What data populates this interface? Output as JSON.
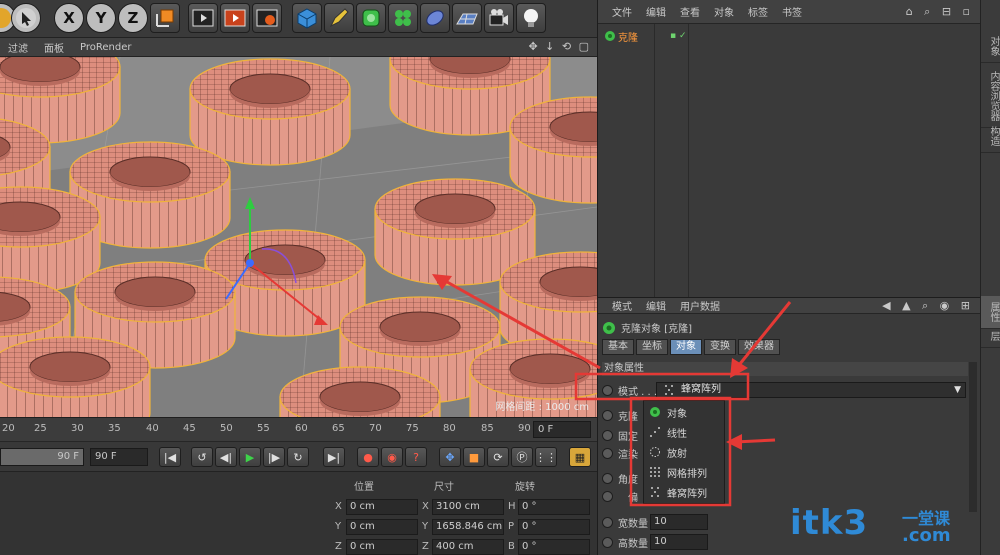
{
  "toolbar": {
    "buttons": [
      {
        "icon": "undo-icon"
      },
      {
        "icon": "select-arrow-icon"
      },
      {
        "icon": "x-axis-lock-icon",
        "label": "X"
      },
      {
        "icon": "y-axis-lock-icon",
        "label": "Y"
      },
      {
        "icon": "z-axis-lock-icon",
        "label": "Z"
      },
      {
        "icon": "coordinate-system-icon"
      },
      {
        "icon": "render-view-icon"
      },
      {
        "icon": "render-picture-viewer-icon"
      },
      {
        "icon": "render-settings-icon"
      },
      {
        "icon": "cube-icon"
      },
      {
        "icon": "pen-icon"
      },
      {
        "icon": "subdivision-icon"
      },
      {
        "icon": "cloner-icon"
      },
      {
        "icon": "deformer-icon"
      },
      {
        "icon": "floor-icon"
      },
      {
        "icon": "camera-icon"
      },
      {
        "icon": "light-icon"
      }
    ]
  },
  "viewport": {
    "menu": [
      "过滤",
      "面板",
      "ProRender"
    ],
    "nav_icons": "✥ ↓ ⟲ ▢",
    "grid_label": "网格间距 : 1000 cm"
  },
  "timeline": {
    "ticks": [
      "20",
      "25",
      "30",
      "35",
      "40",
      "45",
      "50",
      "55",
      "60",
      "65",
      "70",
      "75",
      "80",
      "85",
      "90"
    ],
    "current_frame": "0 F"
  },
  "playback": {
    "end_frame_a": "90 F",
    "end_frame_b": "90 F"
  },
  "coords": {
    "headers": {
      "position": "位置",
      "size": "尺寸",
      "rotation": "旋转"
    },
    "rows": [
      {
        "axis": "X",
        "pos": "0 cm",
        "size_axis": "X",
        "size": "3100 cm",
        "rot_axis": "H",
        "rot": "0 °"
      },
      {
        "axis": "Y",
        "pos": "0 cm",
        "size_axis": "Y",
        "size": "1658.846 cm",
        "rot_axis": "P",
        "rot": "0 °"
      },
      {
        "axis": "Z",
        "pos": "0 cm",
        "size_axis": "Z",
        "size": "400 cm",
        "rot_axis": "B",
        "rot": "0 °"
      }
    ]
  },
  "object_manager": {
    "menu": [
      "文件",
      "编辑",
      "查看",
      "对象",
      "标签",
      "书签"
    ],
    "icons": "⌂ ⌕ ⊟ ▫",
    "object_name": "克隆"
  },
  "side_tabs": {
    "top": [
      "对象",
      "内容浏览器",
      "构造"
    ],
    "bottom": [
      "属性",
      "层"
    ]
  },
  "attributes": {
    "menu": [
      "模式",
      "编辑",
      "用户数据"
    ],
    "icons": "◀ ▲ ⌕ ◉ ⊞",
    "title": "克隆对象 [克隆]",
    "tabs": [
      {
        "label": "基本",
        "active": false
      },
      {
        "label": "坐标",
        "active": false
      },
      {
        "label": "对象",
        "active": true
      },
      {
        "label": "变换",
        "active": false
      },
      {
        "label": "效果器",
        "active": false
      }
    ],
    "section": "对象属性",
    "mode_label": "模式 . . .",
    "mode_value": "蜂窝阵列",
    "partial_labels": [
      "克隆",
      "固定",
      "渲染",
      "角度",
      "偏"
    ],
    "count_labels": [
      {
        "label": "宽数量",
        "value": "10"
      },
      {
        "label": "高数量",
        "value": "10"
      }
    ]
  },
  "dropdown": {
    "options": [
      {
        "label": "对象",
        "icon": "object-mode-icon"
      },
      {
        "label": "线性",
        "icon": "linear-mode-icon"
      },
      {
        "label": "放射",
        "icon": "radial-mode-icon"
      },
      {
        "label": "网格排列",
        "icon": "grid-array-mode-icon"
      },
      {
        "label": "蜂窝阵列",
        "icon": "honeycomb-mode-icon"
      }
    ]
  },
  "watermark": {
    "text": "itk3",
    "sub": ".com",
    "cn": "一堂课"
  },
  "colors": {
    "annotation": "#e53935",
    "accent": "#ff9a3c",
    "active_tab": "#6b8fb8"
  }
}
